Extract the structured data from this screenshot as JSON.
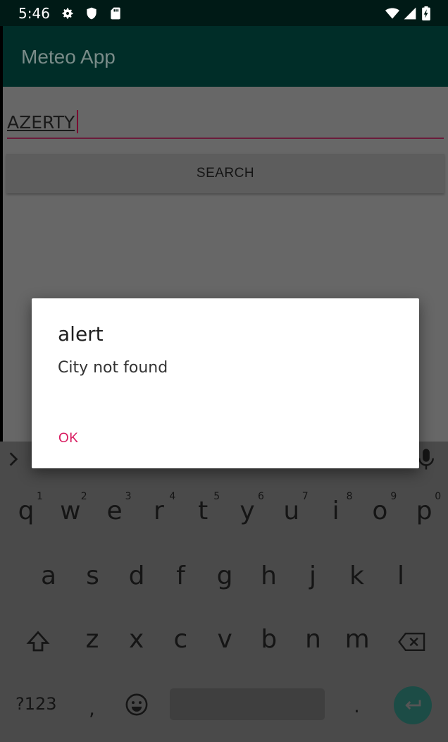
{
  "status_bar": {
    "time": "5:46",
    "icons": [
      "gear-icon",
      "shield-icon",
      "sd-card-icon",
      "wifi-icon",
      "signal-icon",
      "battery-charging-icon"
    ]
  },
  "app_bar": {
    "title": "Meteo App"
  },
  "search": {
    "input_value": "AZERTY",
    "button_label": "SEARCH"
  },
  "dialog": {
    "title": "alert",
    "message": "City not found",
    "ok_label": "OK",
    "accent_color": "#d81b60"
  },
  "keyboard": {
    "row1": [
      "q",
      "w",
      "e",
      "r",
      "t",
      "y",
      "u",
      "i",
      "o",
      "p"
    ],
    "row1_hints": [
      "1",
      "2",
      "3",
      "4",
      "5",
      "6",
      "7",
      "8",
      "9",
      "0"
    ],
    "row2": [
      "a",
      "s",
      "d",
      "f",
      "g",
      "h",
      "j",
      "k",
      "l"
    ],
    "row3": [
      "z",
      "x",
      "c",
      "v",
      "b",
      "n",
      "m"
    ],
    "symbols_label": "?123",
    "comma": ",",
    "period": ".",
    "icons": [
      "chevron-right-icon",
      "microphone-icon",
      "shift-icon",
      "backspace-icon",
      "emoji-icon",
      "enter-icon"
    ]
  },
  "colors": {
    "app_bar": "#002d28",
    "status_bar": "#001a16",
    "accent": "#d81b60"
  }
}
